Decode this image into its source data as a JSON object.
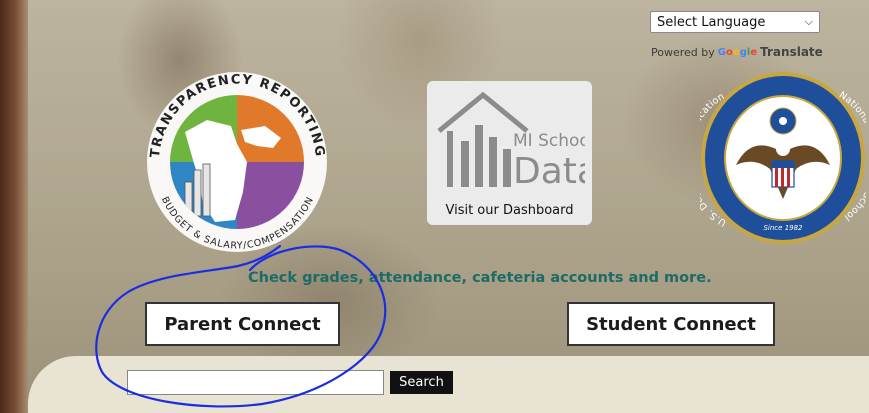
{
  "translate": {
    "selected_language": "Select Language",
    "powered_by": "Powered by",
    "google": [
      "G",
      "o",
      "o",
      "g",
      "l",
      "e"
    ],
    "google_colors": [
      "#4285F4",
      "#EA4335",
      "#FBBC05",
      "#4285F4",
      "#34A853",
      "#EA4335"
    ],
    "translate_word": "Translate"
  },
  "logos": {
    "transparency": {
      "top_text": "TRANSPARENCY REPORTING",
      "bottom_text": "BUDGET & SALARY/COMPENSATION"
    },
    "mi_school_data": {
      "line1": "MI School",
      "line2": "Data",
      "caption": "Visit our Dashboard"
    },
    "blue_ribbon": {
      "left_text": "U.S. Department of Education",
      "right_text": "National Blue Ribbon School",
      "since": "Since 1982"
    }
  },
  "tagline": "Check grades, attendance, cafeteria accounts and more.",
  "buttons": {
    "parent": "Parent Connect",
    "student": "Student Connect"
  },
  "search": {
    "value": "",
    "button_label": "Search"
  },
  "colors": {
    "tagline": "#1c6b66",
    "annotation": "#1a2ee0",
    "seal_blue": "#1f4f9a",
    "seal_gold": "#c8a740"
  }
}
